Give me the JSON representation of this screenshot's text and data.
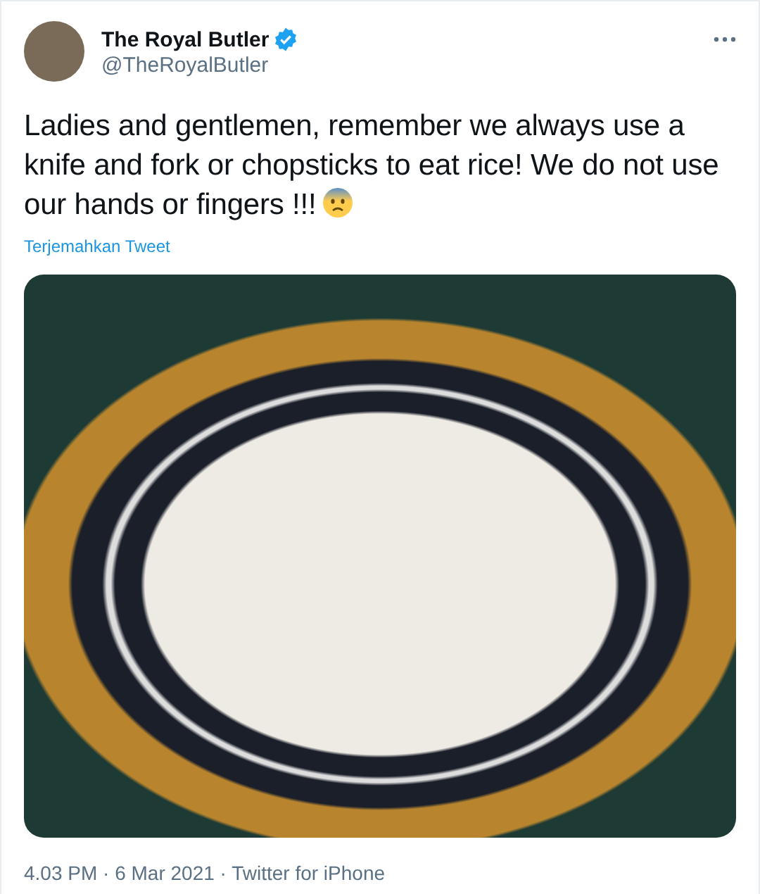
{
  "tweet": {
    "author": {
      "name": "The Royal Butler",
      "verified": true,
      "handle": "@TheRoyalButler"
    },
    "text": "Ladies and gentlemen, remember we always use a knife and fork or chopsticks to eat rice! We do not use our hands or fingers !!!",
    "translate_link": "Terjemahkan Tweet",
    "meta": "4.03 PM · 6 Mar 2021 · Twitter for iPhone"
  }
}
